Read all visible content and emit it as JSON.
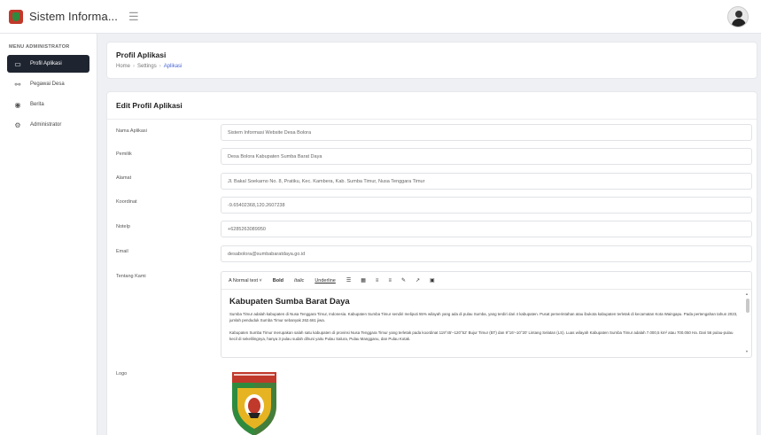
{
  "app": {
    "title": "Sistem Informa..."
  },
  "header_icons": {
    "menu": "hamburger-icon",
    "avatar": "user-avatar"
  },
  "sidebar": {
    "section_title": "MENU ADMINISTRATOR",
    "items": [
      {
        "label": "Profil Aplikasi",
        "icon": "monitor-icon",
        "active": true
      },
      {
        "label": "Pegawai Desa",
        "icon": "users-icon",
        "active": false
      },
      {
        "label": "Berita",
        "icon": "globe-icon",
        "active": false
      },
      {
        "label": "Administrator",
        "icon": "gear-icon",
        "active": false
      }
    ]
  },
  "page": {
    "title": "Profil Aplikasi",
    "breadcrumb": [
      "Home",
      "Settings",
      "Aplikasi"
    ]
  },
  "form": {
    "title": "Edit Profil Aplikasi",
    "fields": [
      {
        "label": "Nama Aplikasi",
        "value": "Sistem Informasi Website Desa Bolora"
      },
      {
        "label": "Pemilik",
        "value": "Desa Bolora Kabupaten Sumba Barat Daya"
      },
      {
        "label": "Alamat",
        "value": "Jl. Bakal Soekarno No. 8, Pratiku, Kec. Kambera, Kab. Sumba Timur, Nusa Tenggara Timur"
      },
      {
        "label": "Koordinat",
        "value": "-9.65402368,120.2607238"
      },
      {
        "label": "Notelp",
        "value": "+6285263089950"
      },
      {
        "label": "Email",
        "value": "desabolora@sumbabaratdaya.go.id"
      }
    ],
    "about_label": "Tentang Kami",
    "logo_label": "Logo",
    "editor": {
      "toolbar": {
        "format": "A Normal text ˅",
        "bold": "Bold",
        "italic": "Italic",
        "underline": "Underline",
        "icons": [
          "ordered-list-icon",
          "bullet-list-icon",
          "align-left-icon",
          "align-justify-icon",
          "pen-icon",
          "link-icon",
          "image-icon"
        ]
      },
      "heading": "Kabupaten Sumba Barat Daya",
      "paragraphs": [
        "Sumba Timur adalah kabupaten di Nusa Tenggara Timur, Indonesia. Kabupaten Sumba Timur sendiri meliputi 55% wilayah yang ada di pulau Sumba, yang terdiri dari 4 kabupaten. Pusat pemerintahan atau ibukota kabupaten terletak di kecamatan Kota Waingapu. Pada pertengahan tahun 2023, jumlah penduduk Sumba Timur sebanyak 262.661 jiwa.",
        "Kabupaten Sumba Timur merupakan salah satu kabupaten di provinsi Nusa Tenggara Timur yang terletak pada koordinat 119°45'–120°52' Bujur Timur (BT) dan 9°16'–10°20' Lintang Selatan (LS). Luas wilayah Kabupaten Sumba Timur adalah 7.000,5 km² atau 700.050 Ha. Dari 56 pulau-pulau kecil di sekelilingnya, hanya 3 pulau sudah dihuni yaitu Pulau Salura, Pulau Mangganu, dan Pulau Kotak."
      ]
    }
  },
  "colors": {
    "sidebar_active": "#1f2530",
    "breadcrumb_current": "#4a67d6",
    "logo_red": "#c0392b",
    "logo_green": "#2e8b3e",
    "logo_gold": "#e6b422"
  }
}
